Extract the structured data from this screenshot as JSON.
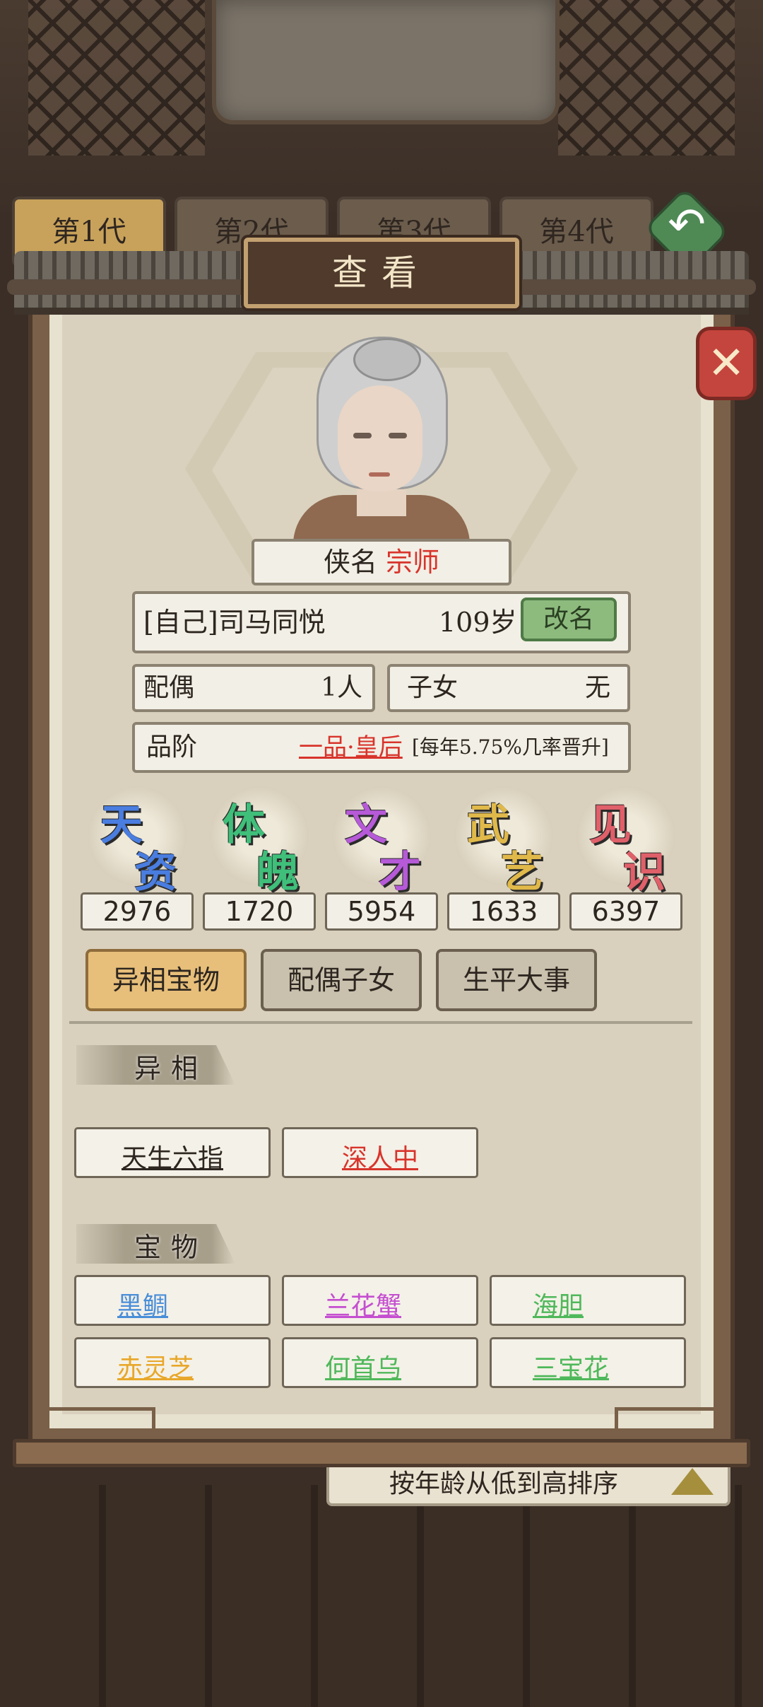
{
  "generations": [
    "第1代",
    "第2代",
    "第3代",
    "第4代"
  ],
  "dialog": {
    "title": "查看",
    "close_icon": "✕"
  },
  "profile": {
    "title_label": "侠名",
    "title_value": "宗师",
    "name": "[自己]司马同悦",
    "age": "109岁",
    "rename_label": "改名",
    "spouse_label": "配偶",
    "spouse_value": "1人",
    "children_label": "子女",
    "children_value": "无",
    "rank_label": "品阶",
    "rank_value": "一品·皇后",
    "rank_note": "[每年5.75%几率晋升]"
  },
  "stats": [
    {
      "chars": [
        "天",
        "资"
      ],
      "value": "2976",
      "color": "#4a7de0"
    },
    {
      "chars": [
        "体",
        "魄"
      ],
      "value": "1720",
      "color": "#3fbf7a"
    },
    {
      "chars": [
        "文",
        "才"
      ],
      "value": "5954",
      "color": "#b65ad8"
    },
    {
      "chars": [
        "武",
        "艺"
      ],
      "value": "1633",
      "color": "#e0b94a"
    },
    {
      "chars": [
        "见",
        "识"
      ],
      "value": "6397",
      "color": "#e0606a"
    }
  ],
  "tabs": [
    "异相宝物",
    "配偶子女",
    "生平大事"
  ],
  "sections": {
    "traits_title": "异相",
    "traits": [
      {
        "label": "天生六指",
        "color": "#2d2620"
      },
      {
        "label": "深人中",
        "color": "#d8342b"
      }
    ],
    "treasures_title": "宝物",
    "treasures": [
      {
        "label": "黑鲷",
        "color": "#4a8ed8"
      },
      {
        "label": "兰花蟹",
        "color": "#c54fd0"
      },
      {
        "label": "海胆",
        "color": "#4fb85a"
      },
      {
        "label": "赤灵芝",
        "color": "#e8a72a"
      },
      {
        "label": "何首乌",
        "color": "#4fb85a"
      },
      {
        "label": "三宝花",
        "color": "#4fb85a"
      }
    ]
  },
  "sort_label": "按年龄从低到高排序"
}
